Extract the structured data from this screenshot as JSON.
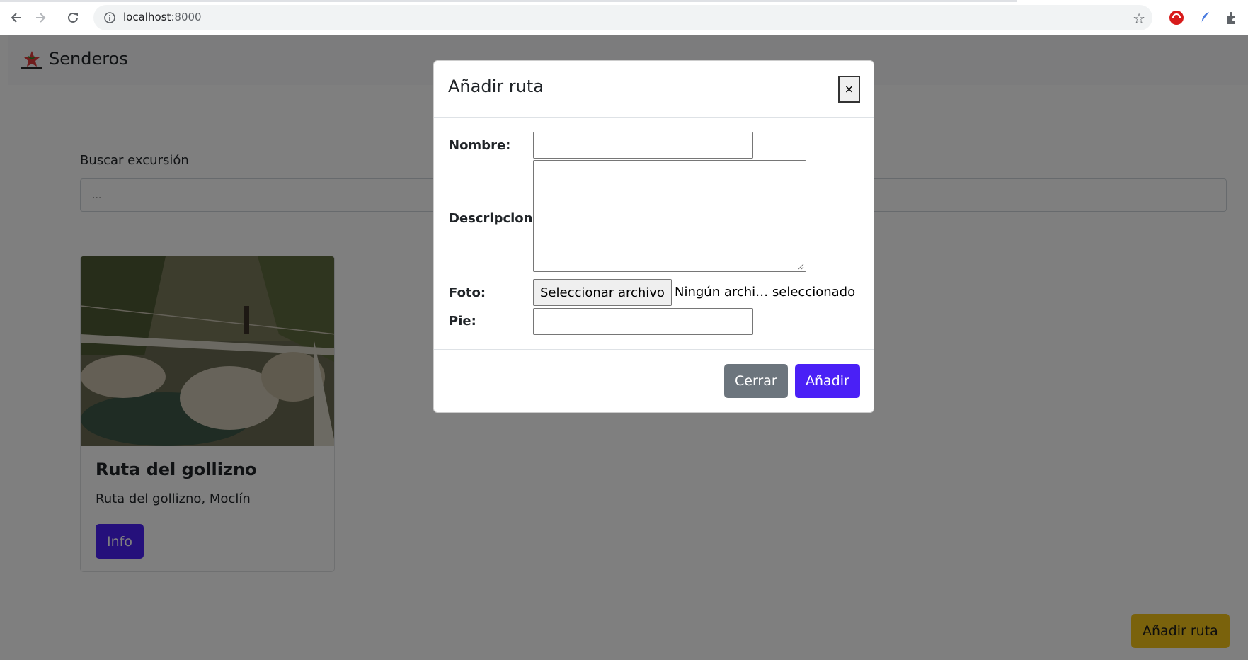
{
  "browser": {
    "url_host": "localhost",
    "url_port": ":8000",
    "back_icon": "arrow-left-icon",
    "forward_icon": "arrow-right-icon",
    "reload_icon": "reload-icon"
  },
  "navbar": {
    "brand": "Senderos"
  },
  "search": {
    "label": "Buscar excursión",
    "placeholder": "..."
  },
  "cards": [
    {
      "title": "Ruta del gollizno",
      "text": "Ruta del gollizno, Moclín",
      "button_label": "Info"
    }
  ],
  "add_route_button": "Añadir ruta",
  "modal": {
    "title": "Añadir ruta",
    "close_label": "×",
    "fields": {
      "nombre_label": "Nombre:",
      "descripcion_label": "Descripcion:",
      "foto_label": "Foto:",
      "pie_label": "Pie:"
    },
    "file_button": "Seleccionar archivo",
    "file_status": "Ningún archi… seleccionado",
    "footer": {
      "close_button": "Cerrar",
      "submit_button": "Añadir"
    }
  },
  "colors": {
    "primary": "#4a20f6",
    "secondary": "#6c757d",
    "warning": "#f5c518"
  }
}
